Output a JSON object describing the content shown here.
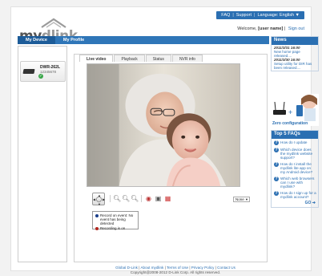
{
  "header": {
    "links": [
      "FAQ",
      "Support",
      "Language: English ▼"
    ],
    "welcome_prefix": "Welcome,",
    "username": "[user name]",
    "signout": "Sign out"
  },
  "logo": {
    "text_my": "my",
    "text_dlink": "dlink"
  },
  "nav": {
    "tabs": [
      "My Device",
      "My Profile"
    ],
    "active": "My Device"
  },
  "device": {
    "name": "DWR-262L",
    "id": "12345678"
  },
  "content": {
    "tabs": [
      "Live video",
      "Playback",
      "Status",
      "NVR info"
    ],
    "active_tab": "Live video",
    "ptz_select": "None",
    "legend": [
      {
        "color": "#1b3f8a",
        "text": "Record on event: No event has being detected"
      },
      {
        "color": "#b3261e",
        "text": "Recording is on"
      }
    ]
  },
  "news": {
    "title": "News",
    "items": [
      {
        "date": "2011/3/31 16:00",
        "text": "New home page released...."
      },
      {
        "date": "2011/3/30 16:00",
        "text": "Setup utility for DIR has been released...."
      }
    ]
  },
  "promo": {
    "label": "Zero configuration"
  },
  "faqs": {
    "title": "Top 5 FAQs",
    "items": [
      "How do I update",
      "Which device does the mydlink website support?",
      "How do I install the mydlink lite app on my Android device?",
      "Which web browsers can I use with mydlink?",
      "How do I sign up for a mydlink account?"
    ],
    "go": "GO"
  },
  "footer": {
    "links": [
      "Global D-Link",
      "About mydlink",
      "Terms of Use",
      "Privacy Policy",
      "Contact Us"
    ],
    "copyright": "Copyright@2008-2012 D-Link Corp. All rights reserved."
  },
  "colors": {
    "brand_blue": "#2b6fb2",
    "nav_blue": "#2f76b8",
    "active_nav": "#1d5c99"
  }
}
